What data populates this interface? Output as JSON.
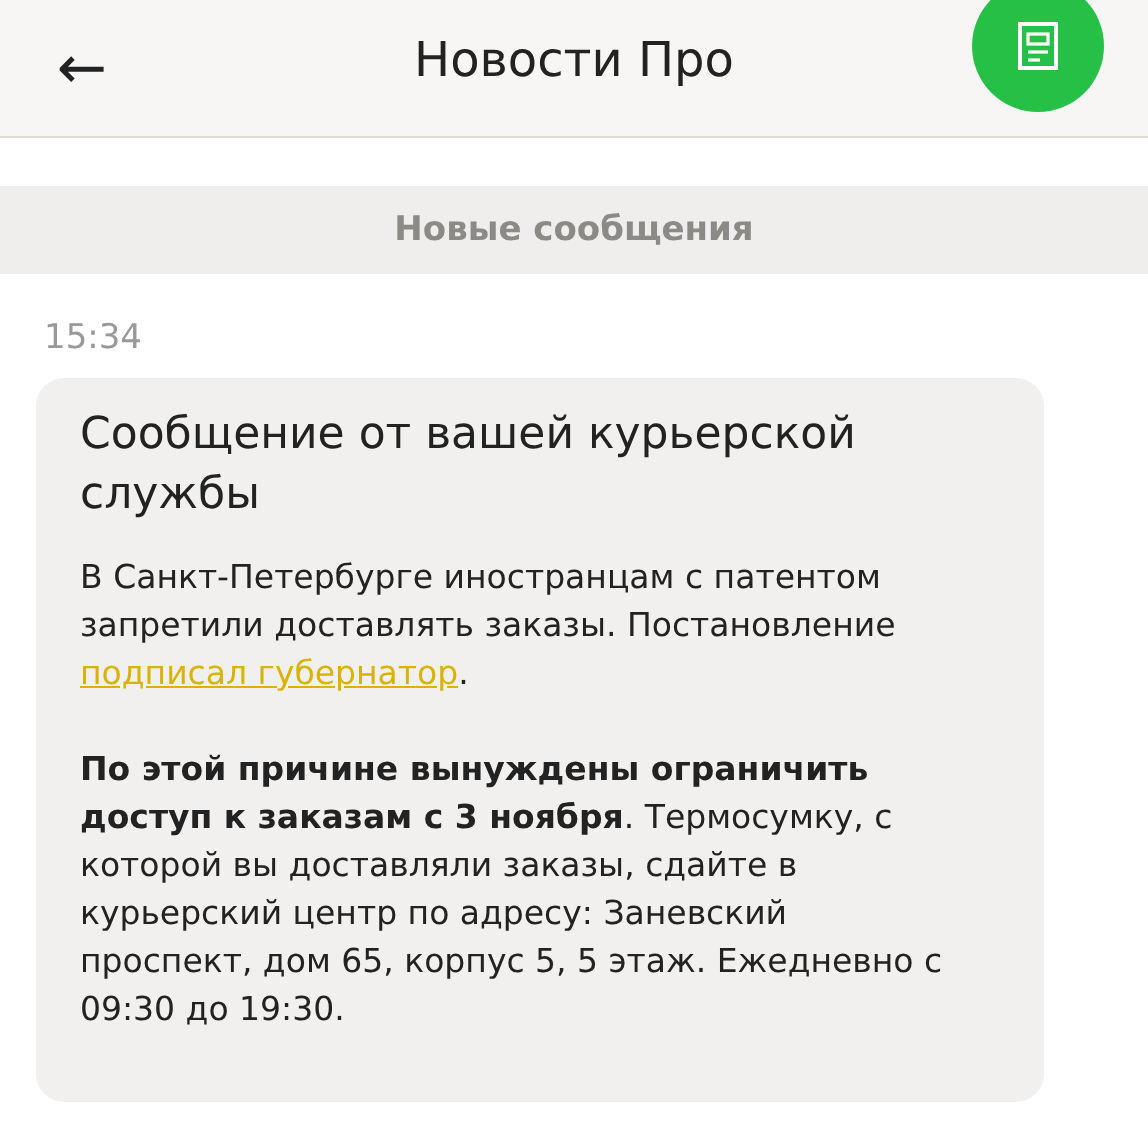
{
  "header": {
    "back_icon": "←",
    "title": "Новости Про"
  },
  "banner": "Новые сообщения",
  "message": {
    "time": "15:34",
    "title": "Сообщение от вашей курьерской службы",
    "paragraph_1": {
      "text": "В Санкт-Петербурге иностранцам с патентом запретили доставлять заказы. Постановление ",
      "link": "подписал губернатор",
      "after": "."
    },
    "paragraph_2": "**По этой причине вынуждены ограничить доступ к заказам с 3 ноября**. Термосумку, с которой вы доставляли заказы, сдайте в курьерский центр по адресу: Заневский проспект, дом 65, корпус 5, 5 этаж. Ежедневно с 09:30 до 19:30."
  }
}
